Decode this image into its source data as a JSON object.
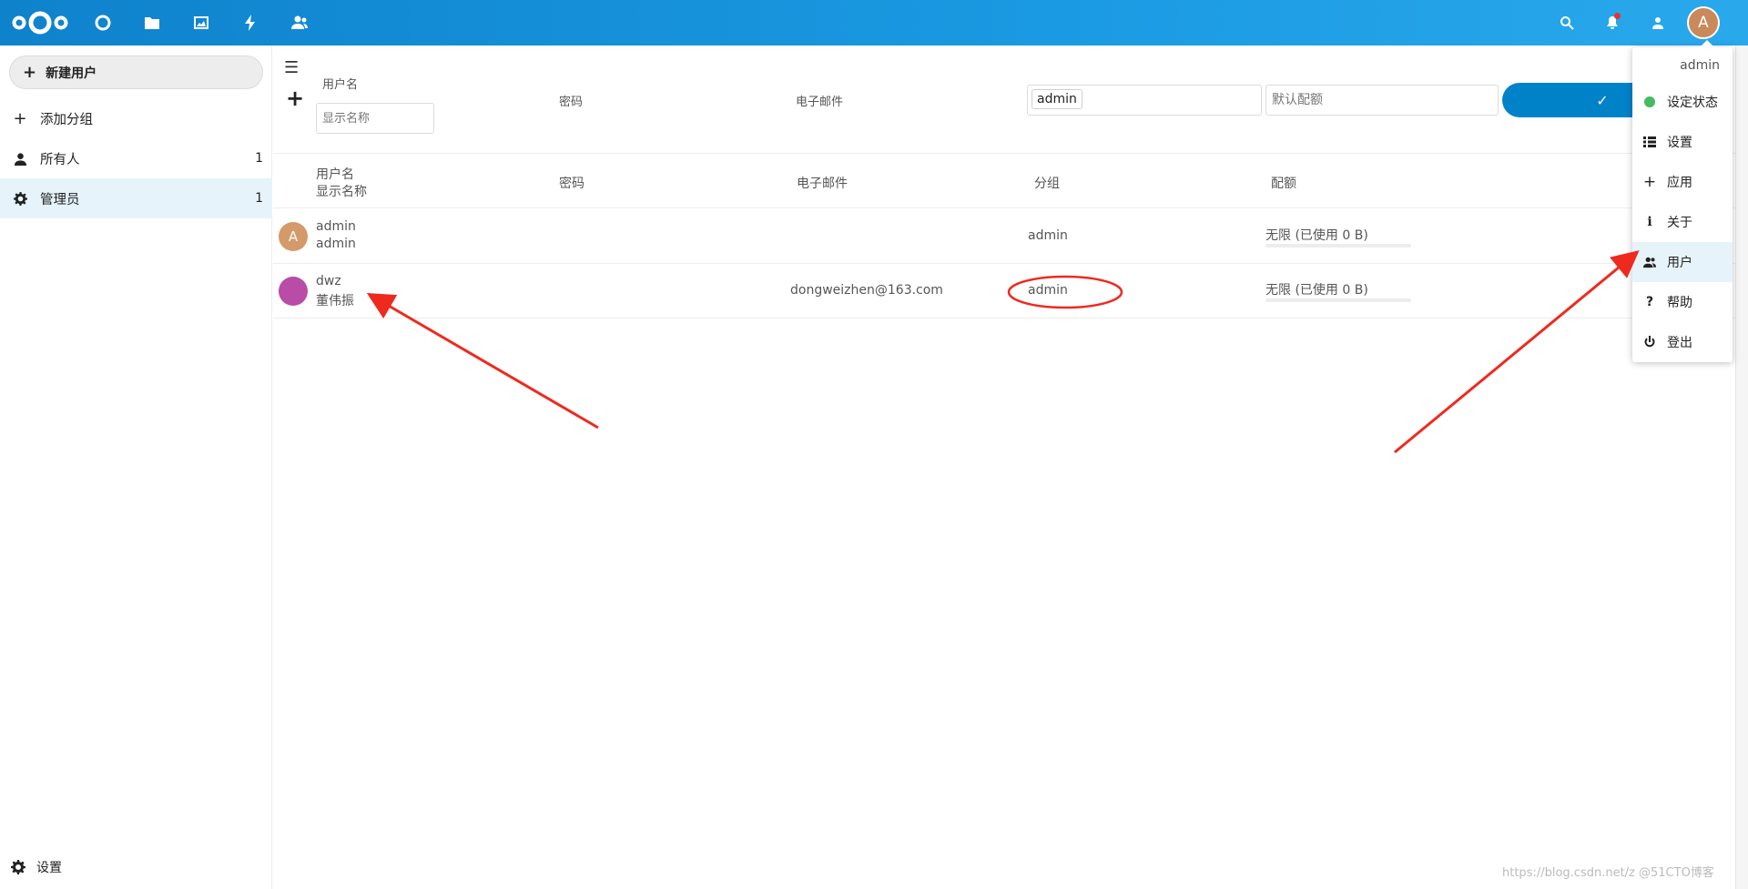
{
  "header": {
    "apps": [
      {
        "icon": "dashboard-icon"
      },
      {
        "icon": "files-icon"
      },
      {
        "icon": "photos-icon"
      },
      {
        "icon": "activity-icon"
      },
      {
        "icon": "contacts-icon"
      }
    ],
    "avatar_letter": "A"
  },
  "nav": {
    "new_user": "新建用户",
    "add_group": "添加分组",
    "everyone": {
      "label": "所有人",
      "count": "1"
    },
    "admins": {
      "label": "管理员",
      "count": "1"
    },
    "settings": "设置"
  },
  "new_user_form": {
    "username_label": "用户名",
    "display_name_placeholder": "显示名称",
    "password_label": "密码",
    "email_label": "电子邮件",
    "group_tag": "admin",
    "quota_placeholder": "默认配额",
    "confirm_glyph": "✓"
  },
  "columns": {
    "username": "用户名",
    "display_name": "显示名称",
    "password": "密码",
    "email": "电子邮件",
    "group": "分组",
    "quota": "配额"
  },
  "users": [
    {
      "avatar": "A",
      "avatar_color": "#d49a6a",
      "username": "admin",
      "display_name": "admin",
      "email": "",
      "group": "admin",
      "quota": "无限 (已使用 0 B)"
    },
    {
      "avatar": "",
      "avatar_color": "#b84ca7",
      "username": "dwz",
      "display_name": "董伟振",
      "email": "dongweizhen@163.com",
      "group": "admin",
      "quota": "无限 (已使用 0 B)"
    }
  ],
  "menu": {
    "user": "admin",
    "items": [
      {
        "label": "设定状态",
        "icon": "status-dot-icon"
      },
      {
        "label": "设置",
        "icon": "settings-list-icon"
      },
      {
        "label": "应用",
        "icon": "plus-icon"
      },
      {
        "label": "关于",
        "icon": "info-icon"
      },
      {
        "label": "用户",
        "icon": "users-icon"
      },
      {
        "label": "帮助",
        "icon": "help-icon"
      },
      {
        "label": "登出",
        "icon": "power-icon"
      }
    ]
  },
  "watermark": "https://blog.csdn.net/z @51CTO博客",
  "colors": {
    "brand": "#0082c9",
    "annotation": "#ee2a1f"
  }
}
